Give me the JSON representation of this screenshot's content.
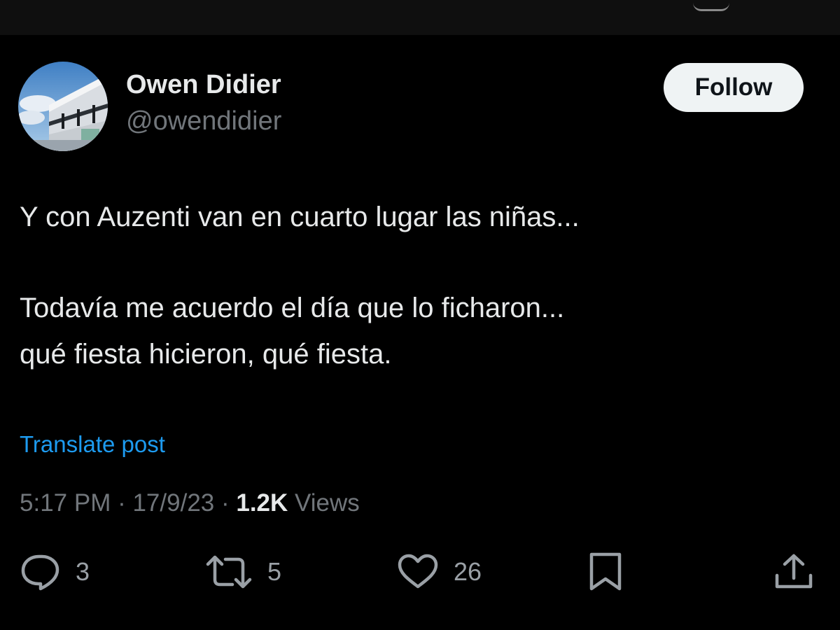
{
  "profile": {
    "display_name": "Owen Didier",
    "handle": "@owendidier"
  },
  "follow_button": {
    "label": "Follow"
  },
  "post": {
    "lines": [
      "Y con Auzenti van en cuarto lugar las niñas...",
      "Todavía me acuerdo el día que lo ficharon...",
      "qué fiesta hicieron, qué fiesta."
    ],
    "translate_label": "Translate post",
    "time": "5:17 PM",
    "date": "17/9/23",
    "separator": " · ",
    "views_count": "1.2K",
    "views_label": "Views"
  },
  "actions": {
    "replies": {
      "icon": "reply-icon",
      "count": "3"
    },
    "reposts": {
      "icon": "repost-icon",
      "count": "5"
    },
    "likes": {
      "icon": "heart-icon",
      "count": "26"
    },
    "bookmark": {
      "icon": "bookmark-icon"
    },
    "share": {
      "icon": "share-icon"
    }
  },
  "colors": {
    "background": "#000000",
    "text_primary": "#e7e9ea",
    "text_secondary": "#71767b",
    "link": "#1d9bf0",
    "follow_bg": "#eff3f4"
  }
}
